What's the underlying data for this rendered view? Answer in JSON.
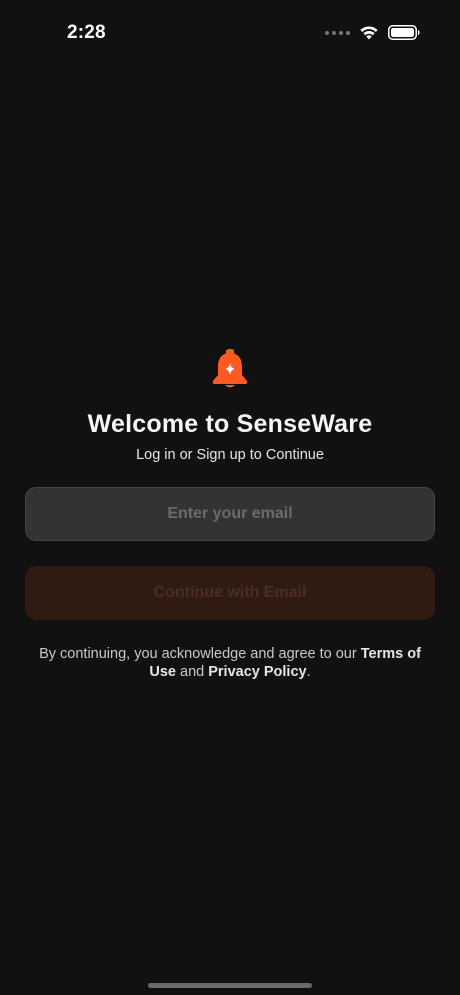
{
  "status_bar": {
    "time": "2:28",
    "icons": [
      "signal-dots-icon",
      "wifi-icon",
      "battery-icon"
    ]
  },
  "colors": {
    "background": "#111111",
    "accent": "#ff5a1f",
    "input_background": "#333333",
    "button_disabled_background": "#301b13",
    "button_disabled_text": "#4a2e22"
  },
  "logo": {
    "icon": "bell-sparkle-icon"
  },
  "welcome": {
    "title": "Welcome to SenseWare",
    "subtitle": "Log in or Sign up to Continue"
  },
  "email": {
    "placeholder": "Enter your email",
    "value": ""
  },
  "continue_button": {
    "label": "Continue with Email",
    "state": "disabled"
  },
  "legal": {
    "prefix": "By continuing, you acknowledge and agree to our ",
    "terms_link": "Terms of Use",
    "middle": " and ",
    "privacy_link": "Privacy Policy",
    "suffix": "."
  }
}
